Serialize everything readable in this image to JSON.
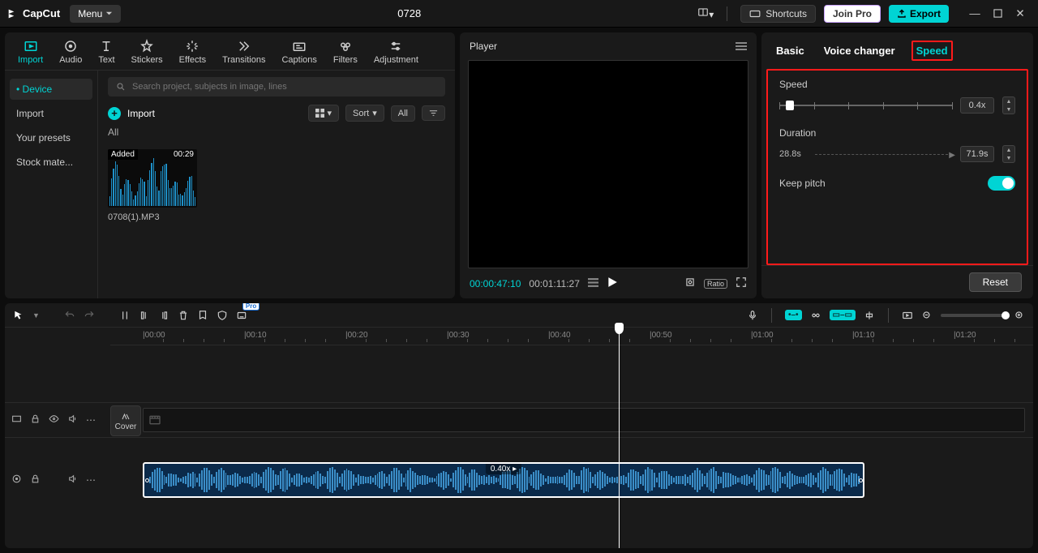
{
  "title": "0728",
  "app_name": "CapCut",
  "menu": "Menu",
  "titlebar": {
    "shortcuts": "Shortcuts",
    "join_pro": "Join Pro",
    "export": "Export"
  },
  "top_tabs": [
    {
      "label": "Import",
      "active": true
    },
    {
      "label": "Audio"
    },
    {
      "label": "Text"
    },
    {
      "label": "Stickers"
    },
    {
      "label": "Effects"
    },
    {
      "label": "Transitions"
    },
    {
      "label": "Captions"
    },
    {
      "label": "Filters"
    },
    {
      "label": "Adjustment"
    }
  ],
  "sidebar": [
    {
      "label": "Device",
      "active": true,
      "prefix": "• "
    },
    {
      "label": "Import"
    },
    {
      "label": "Your presets"
    },
    {
      "label": "Stock mate..."
    }
  ],
  "search_placeholder": "Search project, subjects in image, lines",
  "import_label": "Import",
  "view_controls": {
    "sort": "Sort",
    "all": "All"
  },
  "all_label": "All",
  "media": {
    "added": "Added",
    "duration": "00:29",
    "name": "0708(1).MP3"
  },
  "player": {
    "label": "Player",
    "time_current": "00:00:47:10",
    "time_total": "00:01:11:27"
  },
  "ratio_badge": "Ratio",
  "right_tabs": [
    {
      "label": "Basic"
    },
    {
      "label": "Voice changer"
    },
    {
      "label": "Speed",
      "active": true
    }
  ],
  "speed": {
    "label": "Speed",
    "value": "0.4x",
    "duration_label": "Duration",
    "orig": "28.8s",
    "duration_value": "71.9s",
    "keep_pitch": "Keep pitch"
  },
  "reset": "Reset",
  "pro_badge": "Pro",
  "cover": "Cover",
  "ruler": [
    "|00:00",
    "|00:10",
    "|00:20",
    "|00:30",
    "|00:40",
    "|00:50",
    "|01:00",
    "|01:10",
    "|01:20"
  ],
  "clip_label": "0.40x ▸"
}
